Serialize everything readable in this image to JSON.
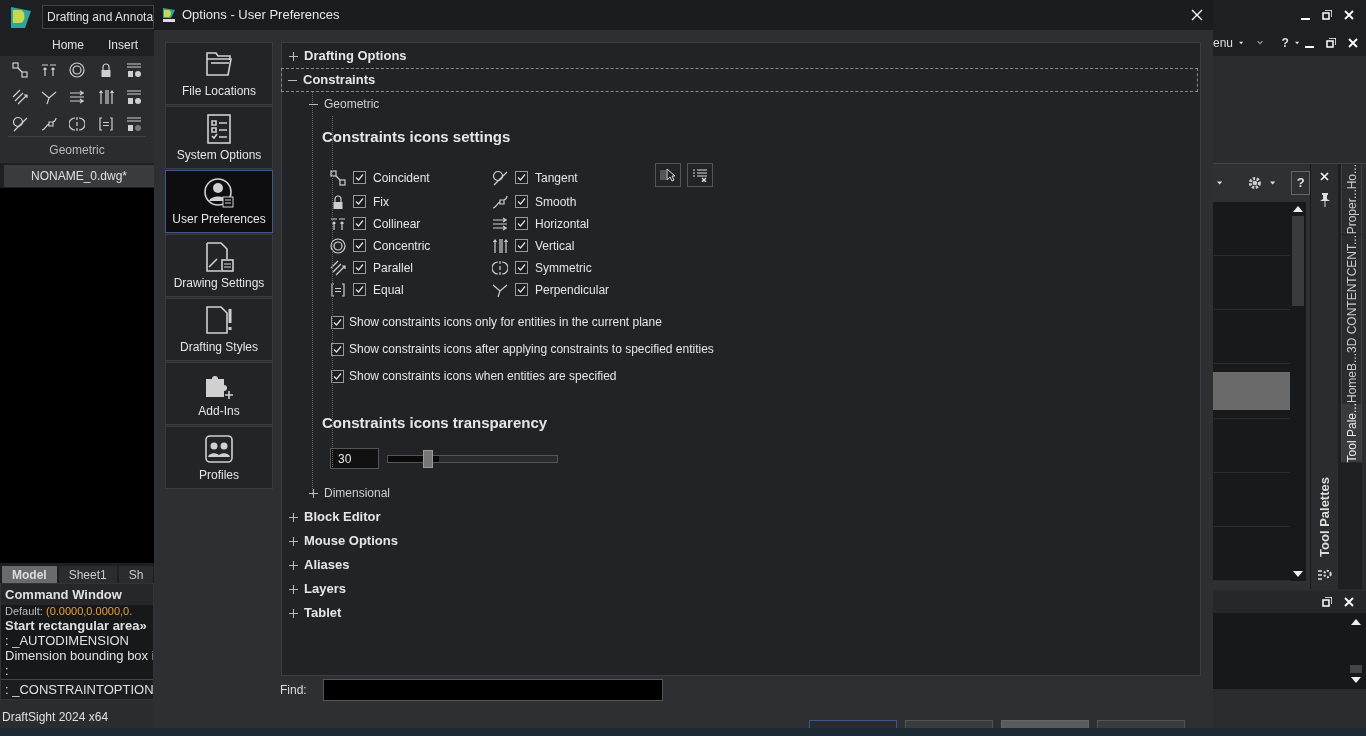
{
  "app": {
    "workspace": "Drafting and Annota",
    "ribbon_tabs": [
      {
        "label": "Home"
      },
      {
        "label": "Insert"
      }
    ],
    "panel_label": "Geometric",
    "document_tab": "NONAME_0.dwg*",
    "layout_tabs": [
      {
        "label": "Model",
        "selected": true
      },
      {
        "label": "Sheet1",
        "selected": false
      },
      {
        "label": "Sh",
        "selected": false
      }
    ],
    "command_window": {
      "title": "Command Window",
      "lines": [
        {
          "kind": "default",
          "label": "Default:",
          "value": "(0.0000,0.0000,0."
        },
        {
          "kind": "bold",
          "text": "Start rectangular area»"
        },
        {
          "kind": "plain",
          "text": ": _AUTODIMENSION"
        },
        {
          "kind": "plain",
          "text": "Dimension bounding box i"
        },
        {
          "kind": "plain",
          "text": ":"
        }
      ],
      "input": ": _CONSTRAINTOPTION"
    },
    "status": "DraftSight 2024 x64"
  },
  "right_panel": {
    "menu_label": "enu",
    "help_label": "?",
    "palette_help_label": "?",
    "palette_title": "Tool Palettes",
    "side_tabs": [
      {
        "label": "Ho...",
        "selected": false
      },
      {
        "label": "Proper...",
        "selected": false
      },
      {
        "label": "3D CONTENTCENT...",
        "selected": false
      },
      {
        "label": "HomeB...",
        "selected": false
      },
      {
        "label": "Tool Pale...",
        "selected": true
      }
    ]
  },
  "dialog": {
    "title": "Options - User Preferences",
    "nav": [
      {
        "label": "File Locations",
        "selected": false
      },
      {
        "label": "System Options",
        "selected": false
      },
      {
        "label": "User Preferences",
        "selected": true
      },
      {
        "label": "Drawing Settings",
        "selected": false
      },
      {
        "label": "Drafting Styles",
        "selected": false
      },
      {
        "label": "Add-Ins",
        "selected": false
      },
      {
        "label": "Profiles",
        "selected": false
      }
    ],
    "tree": [
      {
        "label": "Drafting Options",
        "expanded": false,
        "selected": false
      },
      {
        "label": "Constraints",
        "expanded": true,
        "selected": true,
        "children": [
          {
            "label": "Geometric",
            "expanded": true,
            "selected": false
          },
          {
            "label": "Dimensional",
            "expanded": false,
            "selected": false
          }
        ]
      },
      {
        "label": "Block Editor",
        "expanded": false,
        "selected": false
      },
      {
        "label": "Mouse Options",
        "expanded": false,
        "selected": false
      },
      {
        "label": "Aliases",
        "expanded": false,
        "selected": false
      },
      {
        "label": "Layers",
        "expanded": false,
        "selected": false
      },
      {
        "label": "Tablet",
        "expanded": false,
        "selected": false
      }
    ],
    "geometric": {
      "heading": "Constraints icons settings",
      "constraints": [
        {
          "label": "Coincident",
          "checked": true
        },
        {
          "label": "Fix",
          "checked": true
        },
        {
          "label": "Collinear",
          "checked": true
        },
        {
          "label": "Concentric",
          "checked": true
        },
        {
          "label": "Parallel",
          "checked": true
        },
        {
          "label": "Equal",
          "checked": true
        },
        {
          "label": "Tangent",
          "checked": true
        },
        {
          "label": "Smooth",
          "checked": true
        },
        {
          "label": "Horizontal",
          "checked": true
        },
        {
          "label": "Vertical",
          "checked": true
        },
        {
          "label": "Symmetric",
          "checked": true
        },
        {
          "label": "Perpendicular",
          "checked": true
        }
      ],
      "options": [
        {
          "label": "Show constraints icons only for entities in the current plane",
          "checked": true
        },
        {
          "label": "Show constraints icons after applying constraints to specified entities",
          "checked": true
        },
        {
          "label": "Show constraints icons when entities are specified",
          "checked": true
        }
      ],
      "transparency": {
        "heading": "Constraints icons transparency",
        "value": "30",
        "level": 0.3
      }
    },
    "find_label": "Find:"
  }
}
